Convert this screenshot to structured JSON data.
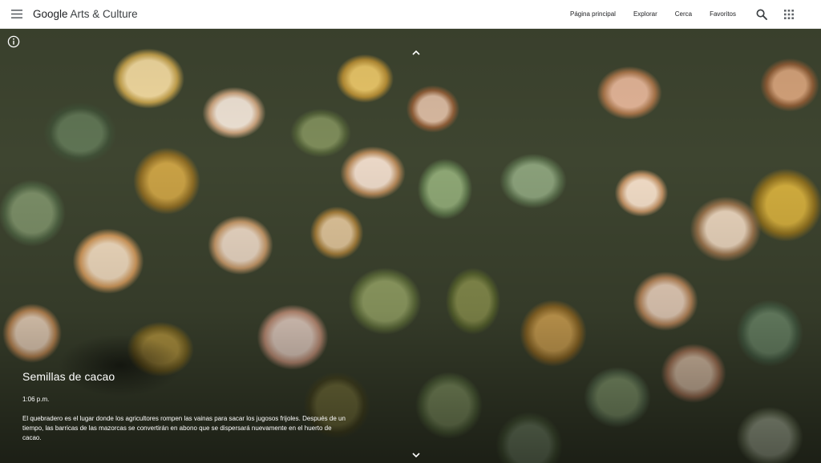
{
  "header": {
    "logo_google": "Google",
    "logo_rest": " Arts & Culture",
    "nav": [
      "Página principal",
      "Explorar",
      "Cerca",
      "Favoritos"
    ]
  },
  "icons": {
    "menu": "hamburger-menu-icon",
    "search": "search-icon",
    "apps": "apps-grid-icon",
    "info": "info-icon",
    "up": "chevron-up-icon",
    "down": "chevron-down-icon"
  },
  "hero": {
    "title": "Semillas de cacao",
    "time": "1:06 p.m.",
    "description": "El quebradero es el lugar donde los agricultores rompen las vainas para sacar los jugosos frijoles. Después de un tiempo, las barricas de las mazorcas se convertirán en abono que se dispersará nuevamente en el huerto de cacao."
  },
  "colors": {
    "header_bg": "#ffffff",
    "text_dark": "#202124",
    "caption_text": "#ffffff"
  }
}
